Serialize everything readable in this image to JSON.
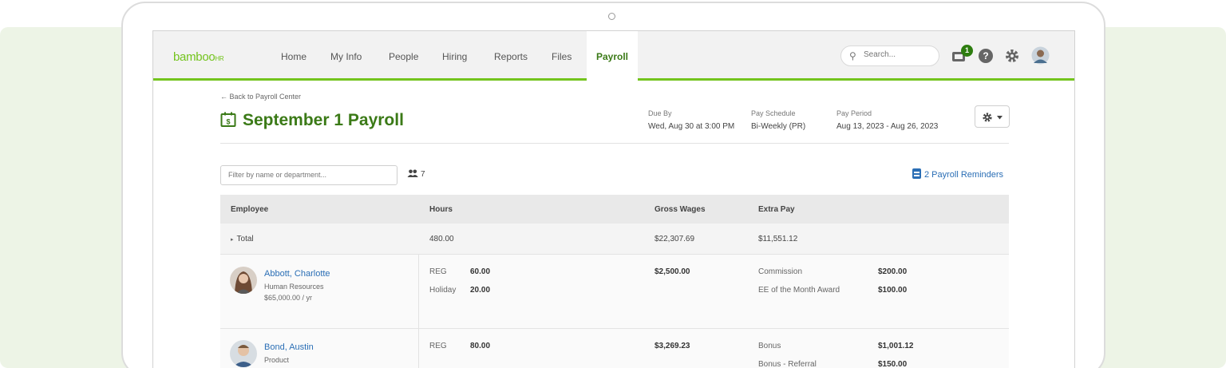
{
  "nav": {
    "logo": "bamboo",
    "logo_suffix": "HR",
    "items": [
      "Home",
      "My Info",
      "People",
      "Hiring",
      "Reports",
      "Files",
      "Payroll"
    ],
    "active": "Payroll",
    "search_placeholder": "Search...",
    "notification_count": "1"
  },
  "header": {
    "back": "← Back to Payroll Center",
    "title": "September 1 Payroll",
    "due_label": "Due By",
    "due_value": "Wed, Aug 30 at 3:00 PM",
    "schedule_label": "Pay Schedule",
    "schedule_value": "Bi-Weekly (PR)",
    "period_label": "Pay Period",
    "period_value": "Aug 13, 2023 - Aug 26, 2023"
  },
  "toolbar": {
    "filter_placeholder": "Filter by name or department...",
    "people_count": "7",
    "reminders": "2 Payroll Reminders"
  },
  "table": {
    "columns": [
      "Employee",
      "Hours",
      "Gross Wages",
      "Extra Pay"
    ],
    "total": {
      "label": "Total",
      "hours": "480.00",
      "gross": "$22,307.69",
      "extra": "$11,551.12"
    },
    "rows": [
      {
        "name": "Abbott, Charlotte",
        "dept": "Human Resources",
        "salary": "$65,000.00 / yr",
        "hours": [
          {
            "type": "REG",
            "value": "60.00"
          },
          {
            "type": "Holiday",
            "value": "20.00"
          }
        ],
        "gross": "$2,500.00",
        "extra": [
          {
            "type": "Commission",
            "amount": "$200.00"
          },
          {
            "type": "EE of the Month Award",
            "amount": "$100.00"
          }
        ]
      },
      {
        "name": "Bond, Austin",
        "dept": "Product",
        "hours": [
          {
            "type": "REG",
            "value": "80.00"
          }
        ],
        "gross": "$3,269.23",
        "extra": [
          {
            "type": "Bonus",
            "amount": "$1,001.12"
          },
          {
            "type": "Bonus - Referral",
            "amount": "$150.00"
          }
        ]
      }
    ]
  },
  "colors": {
    "brand_green": "#73c41d",
    "title_green": "#3b7a17",
    "link_blue": "#2a6eb5",
    "band": "#edf4e6"
  }
}
